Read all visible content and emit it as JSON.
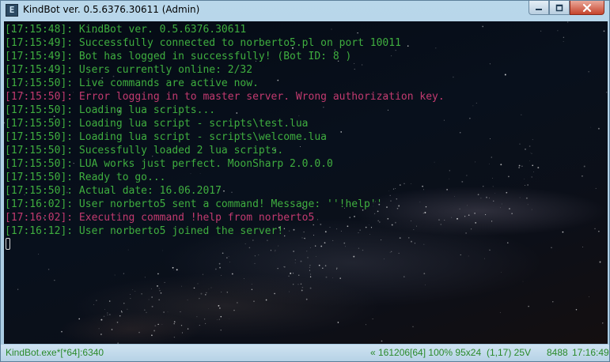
{
  "window": {
    "title": "KindBot ver. 0.5.6376.30611 (Admin)",
    "app_icon_glyph": "E"
  },
  "colors": {
    "normal": "#3fae3f",
    "error": "#c23a6f"
  },
  "console": {
    "lines": [
      {
        "time": "[17:15:48]:",
        "text": " KindBot ver. 0.5.6376.30611",
        "type": "normal"
      },
      {
        "time": "[17:15:49]:",
        "text": " Successfully connected to norberto5.pl on port 10011",
        "type": "normal"
      },
      {
        "time": "[17:15:49]:",
        "text": " Bot has logged in successfully! (Bot ID: 8 )",
        "type": "normal"
      },
      {
        "time": "[17:15:49]:",
        "text": " Users currently online: 2/32",
        "type": "normal"
      },
      {
        "time": "[17:15:50]:",
        "text": " Live commands are active now.",
        "type": "normal"
      },
      {
        "time": "[17:15:50]:",
        "text": " Error logging in to master server. Wrong authorization key.",
        "type": "error"
      },
      {
        "time": "[17:15:50]:",
        "text": " Loading lua scripts...",
        "type": "normal"
      },
      {
        "time": "[17:15:50]:",
        "text": " Loading lua script - scripts\\test.lua",
        "type": "normal"
      },
      {
        "time": "[17:15:50]:",
        "text": " Loading lua script - scripts\\welcome.lua",
        "type": "normal"
      },
      {
        "time": "[17:15:50]:",
        "text": " Sucessfully loaded 2 lua scripts.",
        "type": "normal"
      },
      {
        "time": "[17:15:50]:",
        "text": " LUA works just perfect. MoonSharp 2.0.0.0",
        "type": "normal"
      },
      {
        "time": "[17:15:50]:",
        "text": " Ready to go...",
        "type": "normal"
      },
      {
        "time": "[17:15:50]:",
        "text": " Actual date: 16.06.2017",
        "type": "normal"
      },
      {
        "time": "[17:16:02]:",
        "text": " User norberto5 sent a command! Message: ''!help''",
        "type": "normal"
      },
      {
        "time": "[17:16:02]:",
        "text": " Executing command !help from norberto5",
        "type": "error"
      },
      {
        "time": "[17:16:12]:",
        "text": " User norberto5 joined the server!",
        "type": "normal"
      }
    ]
  },
  "statusbar": {
    "process": "KindBot.exe*[*64]:6340",
    "buffer_info": "« 161206[64] 100% 95x24",
    "cursor_pos": "(1,17) 25V",
    "pid": "8488",
    "clock": "17:16:49"
  }
}
